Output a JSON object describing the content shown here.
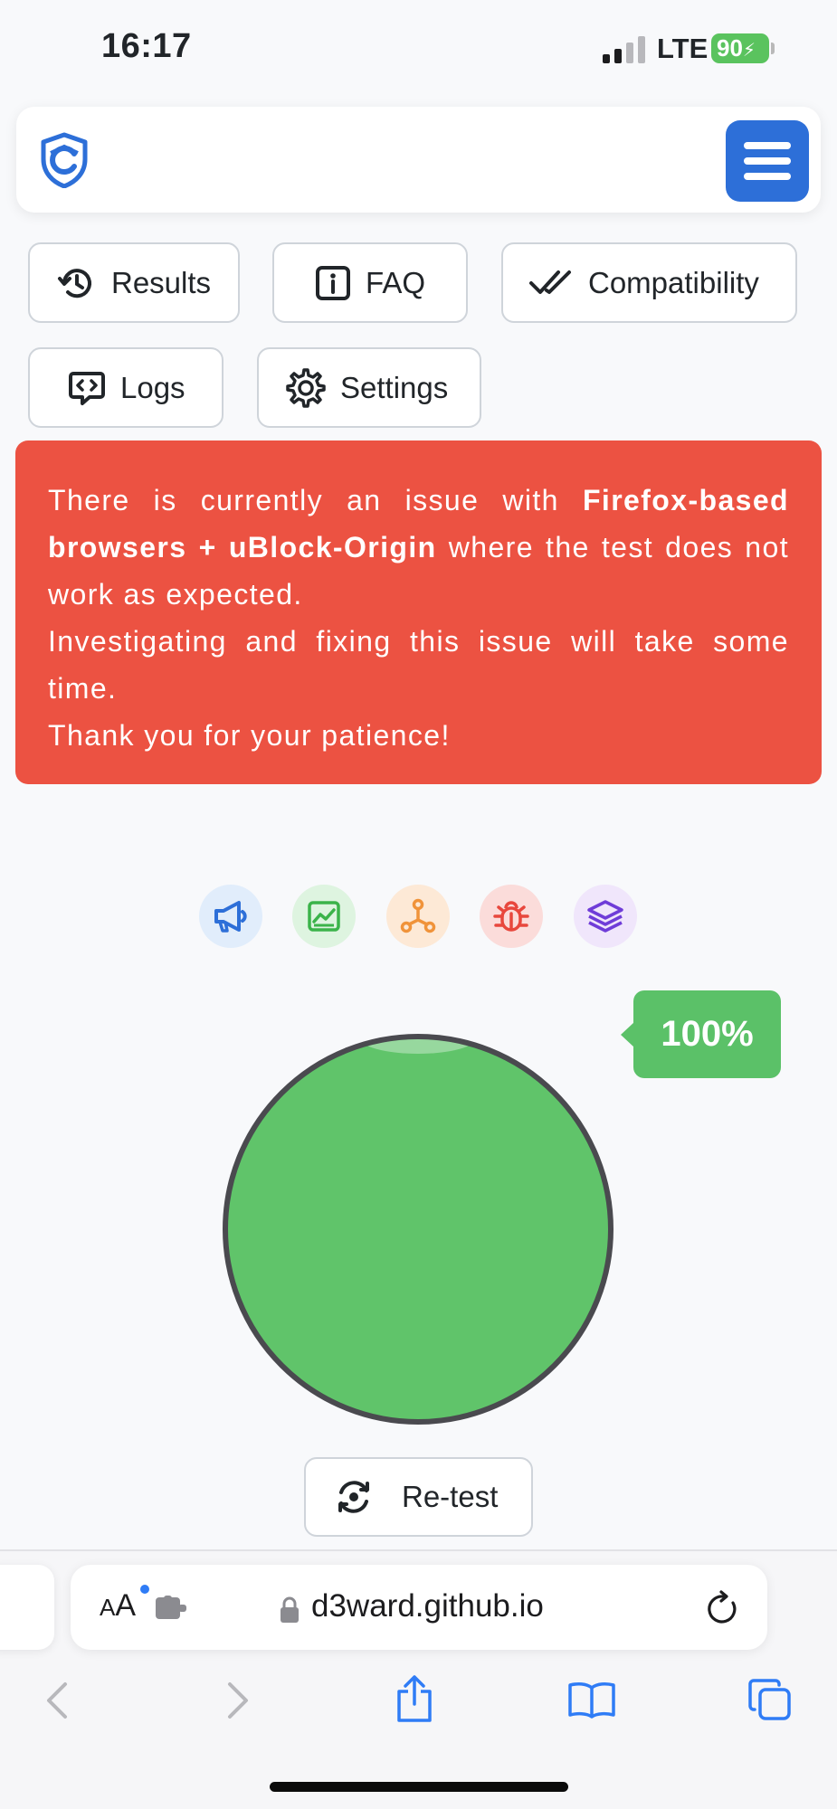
{
  "status_bar": {
    "time": "16:17",
    "network": "LTE",
    "battery": "90"
  },
  "nav": {
    "buttons": [
      {
        "label": "Results",
        "icon": "history-icon"
      },
      {
        "label": "FAQ",
        "icon": "info-icon"
      },
      {
        "label": "Compatibility",
        "icon": "double-check-icon"
      },
      {
        "label": "Logs",
        "icon": "log-icon"
      },
      {
        "label": "Settings",
        "icon": "gear-icon"
      }
    ]
  },
  "alert": {
    "line1_pre": "There is currently an issue with ",
    "line1_bold": "Firefox-based browsers + uBlock-Origin",
    "line1_post": " where the test does not work as expected.",
    "line2": "Investigating and fixing this issue will take some time.",
    "line3": "Thank you for your patience!",
    "color": "#ec5242"
  },
  "categories": [
    {
      "icon": "megaphone-icon",
      "color": "#2d6fd8",
      "bg": "#e1edfb"
    },
    {
      "icon": "chart-icon",
      "color": "#3bb34a",
      "bg": "#def4e0"
    },
    {
      "icon": "network-icon",
      "color": "#f0933a",
      "bg": "#fde9d6"
    },
    {
      "icon": "bug-icon",
      "color": "#e8473d",
      "bg": "#fbdcda"
    },
    {
      "icon": "layers-icon",
      "color": "#6f3cd8",
      "bg": "#f0e6fb"
    }
  ],
  "score": {
    "percent": "100%",
    "value": 1.0,
    "color": "#60c46a"
  },
  "retest_label": "Re-test",
  "browser": {
    "aa_label": "AA",
    "url": "d3ward.github.io"
  }
}
